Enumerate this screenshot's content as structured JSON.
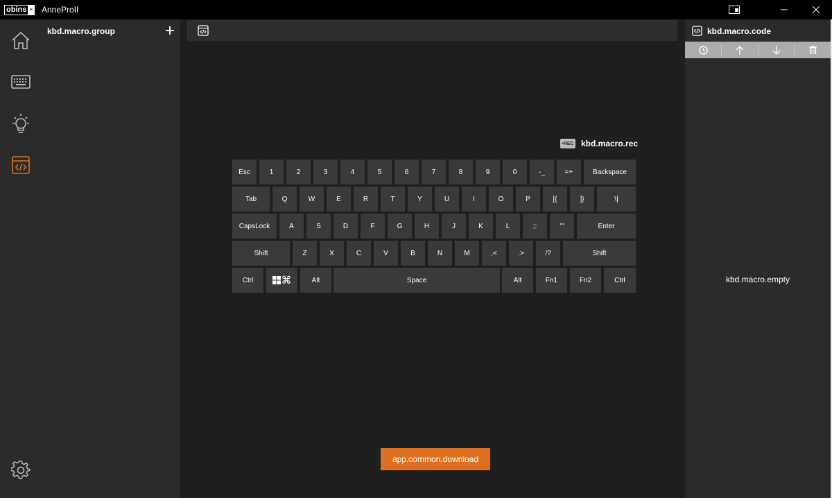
{
  "titlebar": {
    "logo_text": "obins",
    "logo_tag": "≡",
    "app_name": "AnneProII"
  },
  "nav": {
    "items": [
      {
        "name": "home",
        "icon": "home-icon",
        "active": false
      },
      {
        "name": "keyboard",
        "icon": "keyboard-icon",
        "active": false
      },
      {
        "name": "lighting",
        "icon": "bulb-icon",
        "active": false
      },
      {
        "name": "macro",
        "icon": "code-window-icon",
        "active": true
      }
    ],
    "settings_icon": "gear-icon"
  },
  "group_panel": {
    "title": "kbd.macro.group",
    "add_label": "+"
  },
  "record": {
    "icon_text": "•REC",
    "label": "kbd.macro.rec"
  },
  "keyboard": {
    "rows": [
      [
        "Esc",
        "1",
        "2",
        "3",
        "4",
        "5",
        "6",
        "7",
        "8",
        "9",
        "0",
        "-_",
        "=+",
        "Backspace"
      ],
      [
        "Tab",
        "Q",
        "W",
        "E",
        "R",
        "T",
        "Y",
        "U",
        "I",
        "O",
        "P",
        "[{",
        "]}",
        "\\|"
      ],
      [
        "CapsLock",
        "A",
        "S",
        "D",
        "F",
        "G",
        "H",
        "J",
        "K",
        "L",
        ";:",
        "'\"",
        "Enter"
      ],
      [
        "Shift",
        "Z",
        "X",
        "C",
        "V",
        "B",
        "N",
        "M",
        ",<",
        ".>",
        "/?",
        "Shift"
      ],
      [
        "Ctrl",
        "⌘",
        "Alt",
        "Space",
        "Alt",
        "Fn1",
        "Fn2",
        "Ctrl"
      ]
    ]
  },
  "download": {
    "label": "app.common.download"
  },
  "code_panel": {
    "title": "kbd.macro.code",
    "tools": [
      "clock-icon",
      "arrow-up-icon",
      "arrow-down-icon",
      "trash-icon"
    ],
    "empty_text": "kbd.macro.empty"
  },
  "colors": {
    "accent": "#dd7020",
    "rail": "#2b2b2b",
    "canvas": "#1f1f1f",
    "key": "#3a3a3a"
  }
}
